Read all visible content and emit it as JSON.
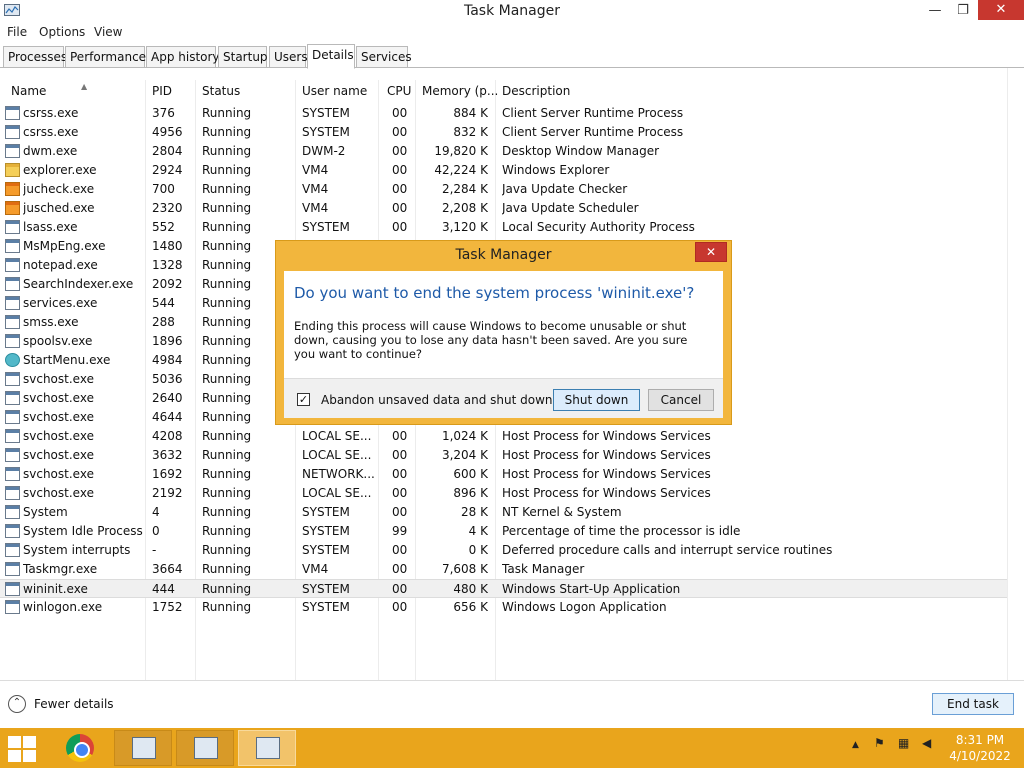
{
  "window": {
    "title": "Task Manager",
    "minimize": "—",
    "maximize": "❐",
    "close": "✕"
  },
  "menu": [
    "File",
    "Options",
    "View"
  ],
  "tabs": [
    "Processes",
    "Performance",
    "App history",
    "Startup",
    "Users",
    "Details",
    "Services"
  ],
  "active_tab": "Details",
  "columns": [
    "Name",
    "PID",
    "Status",
    "User name",
    "CPU",
    "Memory (p...",
    "Description"
  ],
  "rows": [
    [
      "csrss.exe",
      "376",
      "Running",
      "SYSTEM",
      "00",
      "884 K",
      "Client Server Runtime Process"
    ],
    [
      "csrss.exe",
      "4956",
      "Running",
      "SYSTEM",
      "00",
      "832 K",
      "Client Server Runtime Process"
    ],
    [
      "dwm.exe",
      "2804",
      "Running",
      "DWM-2",
      "00",
      "19,820 K",
      "Desktop Window Manager"
    ],
    [
      "explorer.exe",
      "2924",
      "Running",
      "VM4",
      "00",
      "42,224 K",
      "Windows Explorer"
    ],
    [
      "jucheck.exe",
      "700",
      "Running",
      "VM4",
      "00",
      "2,284 K",
      "Java Update Checker"
    ],
    [
      "jusched.exe",
      "2320",
      "Running",
      "VM4",
      "00",
      "2,208 K",
      "Java Update Scheduler"
    ],
    [
      "lsass.exe",
      "552",
      "Running",
      "SYSTEM",
      "00",
      "3,120 K",
      "Local Security Authority Process"
    ],
    [
      "MsMpEng.exe",
      "1480",
      "Running",
      "",
      "",
      "",
      ""
    ],
    [
      "notepad.exe",
      "1328",
      "Running",
      "",
      "",
      "",
      ""
    ],
    [
      "SearchIndexer.exe",
      "2092",
      "Running",
      "",
      "",
      "",
      ""
    ],
    [
      "services.exe",
      "544",
      "Running",
      "",
      "",
      "",
      ""
    ],
    [
      "smss.exe",
      "288",
      "Running",
      "",
      "",
      "",
      ""
    ],
    [
      "spoolsv.exe",
      "1896",
      "Running",
      "",
      "",
      "",
      ""
    ],
    [
      "StartMenu.exe",
      "4984",
      "Running",
      "",
      "",
      "",
      ""
    ],
    [
      "svchost.exe",
      "5036",
      "Running",
      "",
      "",
      "",
      ""
    ],
    [
      "svchost.exe",
      "2640",
      "Running",
      "",
      "",
      "",
      ""
    ],
    [
      "svchost.exe",
      "4644",
      "Running",
      "",
      "",
      "",
      ""
    ],
    [
      "svchost.exe",
      "4208",
      "Running",
      "LOCAL SE...",
      "00",
      "1,024 K",
      "Host Process for Windows Services"
    ],
    [
      "svchost.exe",
      "3632",
      "Running",
      "LOCAL SE...",
      "00",
      "3,204 K",
      "Host Process for Windows Services"
    ],
    [
      "svchost.exe",
      "1692",
      "Running",
      "NETWORK...",
      "00",
      "600 K",
      "Host Process for Windows Services"
    ],
    [
      "svchost.exe",
      "2192",
      "Running",
      "LOCAL SE...",
      "00",
      "896 K",
      "Host Process for Windows Services"
    ],
    [
      "System",
      "4",
      "Running",
      "SYSTEM",
      "00",
      "28 K",
      "NT Kernel & System"
    ],
    [
      "System Idle Process",
      "0",
      "Running",
      "SYSTEM",
      "99",
      "4 K",
      "Percentage of time the processor is idle"
    ],
    [
      "System interrupts",
      "-",
      "Running",
      "SYSTEM",
      "00",
      "0 K",
      "Deferred procedure calls and interrupt service routines"
    ],
    [
      "Taskmgr.exe",
      "3664",
      "Running",
      "VM4",
      "00",
      "7,608 K",
      "Task Manager"
    ],
    [
      "wininit.exe",
      "444",
      "Running",
      "SYSTEM",
      "00",
      "480 K",
      "Windows Start-Up Application"
    ],
    [
      "winlogon.exe",
      "1752",
      "Running",
      "SYSTEM",
      "00",
      "656 K",
      "Windows Logon Application"
    ]
  ],
  "row_icons": [
    "process-icon",
    "process-icon",
    "process-icon",
    "folder-icon",
    "java-icon",
    "java-icon",
    "process-icon",
    "process-icon",
    "process-icon",
    "process-icon",
    "process-icon",
    "process-icon",
    "process-icon",
    "startmenu-icon",
    "process-icon",
    "process-icon",
    "process-icon",
    "process-icon",
    "process-icon",
    "process-icon",
    "process-icon",
    "process-icon",
    "process-icon",
    "process-icon",
    "process-icon",
    "process-icon",
    "process-icon"
  ],
  "selected_row": "wininit.exe",
  "footer": {
    "fewer_details": "Fewer details",
    "end_task": "End task"
  },
  "dialog": {
    "title": "Task Manager",
    "close": "✕",
    "heading": "Do you want to end the system process 'wininit.exe'?",
    "text": "Ending this process will cause Windows to become unusable or shut down, causing you to lose any data hasn't been saved. Are you sure you want to continue?",
    "checkbox_label": "Abandon unsaved data and shut down.",
    "checkbox_checked": true,
    "primary_button": "Shut down",
    "secondary_button": "Cancel"
  },
  "taskbar": {
    "time": "8:31 PM",
    "date": "4/10/2022",
    "tray_chevron": "▲"
  },
  "colors": {
    "taskbar": "#e9a51c",
    "dialog_frame": "#f2b63d",
    "close_red": "#c7372f",
    "heading_blue": "#1e5aa8"
  }
}
